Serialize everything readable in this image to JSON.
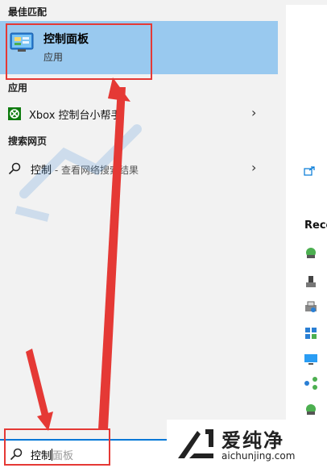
{
  "sections": {
    "best_match": "最佳匹配",
    "apps": "应用",
    "web": "搜索网页"
  },
  "best_match": {
    "title": "控制面板",
    "subtitle": "应用",
    "icon": "control-panel-icon"
  },
  "apps": [
    {
      "label": "Xbox 控制台小帮手",
      "icon": "xbox-icon"
    }
  ],
  "web_results": [
    {
      "query": "控制",
      "suffix": " - 查看网络搜索结果",
      "icon": "search-icon"
    }
  ],
  "search": {
    "typed": "控制",
    "suggestion": "面板"
  },
  "right_pane": {
    "recent_label": "Rece",
    "recent_icons": [
      "network-icon",
      "device-icon",
      "printer-icon",
      "network-grid-icon",
      "monitor-icon",
      "share-icon",
      "network-icon-2"
    ]
  },
  "watermark": {
    "text": "爱纯净",
    "url": "aichunjing.com"
  },
  "colors": {
    "highlight": "#99c9ef",
    "annotation": "#e53935",
    "accent": "#0078d7"
  }
}
